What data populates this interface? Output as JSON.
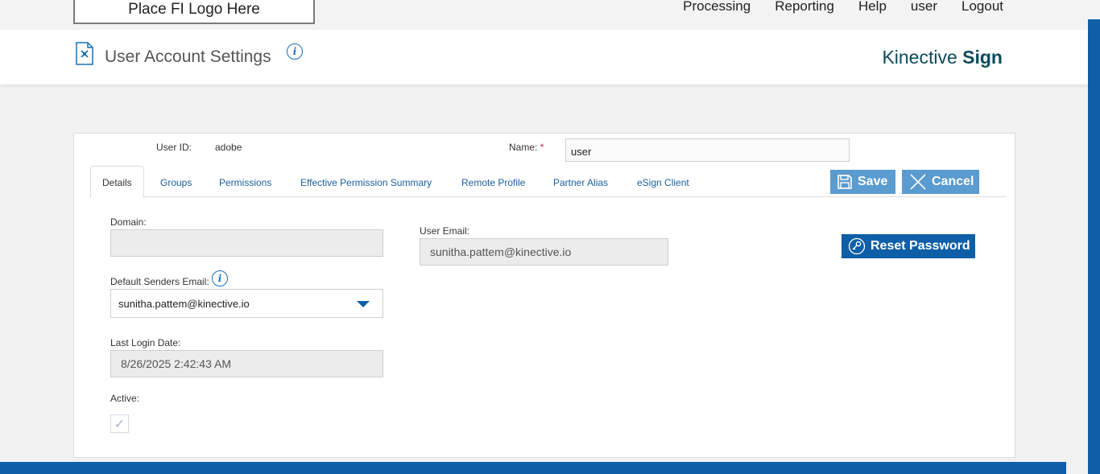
{
  "topbar": {
    "logo_text": "Place FI Logo Here",
    "nav": [
      "Processing",
      "Reporting",
      "Help",
      "user",
      "Logout"
    ]
  },
  "header": {
    "title": "User Account Settings",
    "brand_prefix": "Kinective",
    "brand_suffix": "Sign"
  },
  "form": {
    "user_id_label": "User ID:",
    "user_id_value": "adobe",
    "name_label": "Name:",
    "name_required": "*",
    "name_value": "user",
    "domain_label": "Domain:",
    "domain_value": "",
    "user_email_label": "User Email:",
    "user_email_value": "sunitha.pattem@kinective.io",
    "default_senders_label": "Default Senders Email:",
    "default_senders_value": "sunitha.pattem@kinective.io",
    "last_login_label": "Last Login Date:",
    "last_login_value": "8/26/2025 2:42:43 AM",
    "active_label": "Active:",
    "active_checked": true
  },
  "tabs": [
    {
      "label": "Details",
      "active": true
    },
    {
      "label": "Groups"
    },
    {
      "label": "Permissions"
    },
    {
      "label": "Effective Permission Summary"
    },
    {
      "label": "Remote Profile"
    },
    {
      "label": "Partner Alias"
    },
    {
      "label": "eSign Client"
    }
  ],
  "buttons": {
    "save": "Save",
    "cancel": "Cancel",
    "reset_password": "Reset Password"
  },
  "colors": {
    "accent": "#0f5fa8",
    "button_light": "#5a9bd0",
    "brand_text": "#0d4a5a"
  }
}
